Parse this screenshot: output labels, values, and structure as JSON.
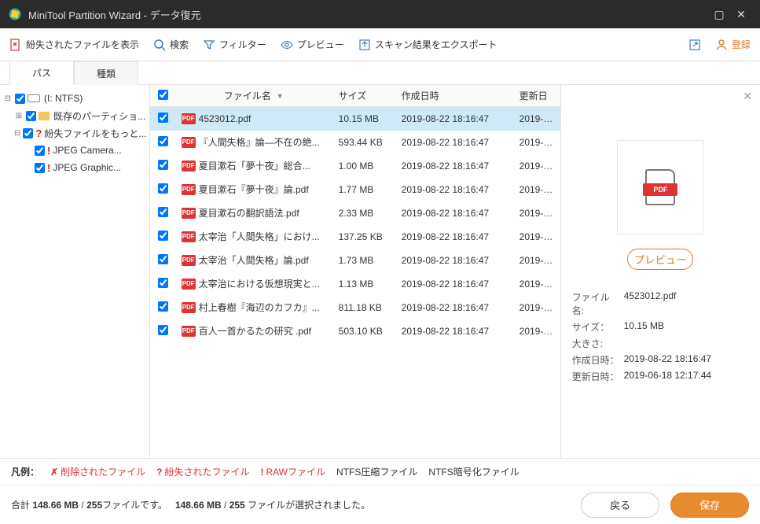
{
  "titlebar": {
    "title": "MiniTool Partition Wizard - データ復元"
  },
  "toolbar": {
    "show_lost": "紛失されたファイルを表示",
    "search": "検索",
    "filter": "フィルター",
    "preview": "プレビュー",
    "export": "スキャン結果をエクスポート",
    "login": "登録"
  },
  "tabs": {
    "path": "パス",
    "type": "種類"
  },
  "tree": {
    "root": "(I: NTFS)",
    "existing": "既存のパーティショ...",
    "lost": "紛失ファイルをもっと...",
    "jpeg_camera": "JPEG Camera...",
    "jpeg_graphic": "JPEG Graphic..."
  },
  "columns": {
    "name": "ファイル名",
    "size": "サイズ",
    "created": "作成日時",
    "updated": "更新日"
  },
  "files": [
    {
      "name": "4523012.pdf",
      "size": "10.15 MB",
      "created": "2019-08-22 18:16:47",
      "updated": "2019-0...",
      "selected": true
    },
    {
      "name": "『人間失格』論―不在の絶...",
      "size": "593.44 KB",
      "created": "2019-08-22 18:16:47",
      "updated": "2019-0..."
    },
    {
      "name": "夏目漱石「夢十夜」総合...",
      "size": "1.00 MB",
      "created": "2019-08-22 18:16:47",
      "updated": "2019-0..."
    },
    {
      "name": "夏目漱石『夢十夜』論.pdf",
      "size": "1.77 MB",
      "created": "2019-08-22 18:16:47",
      "updated": "2019-0..."
    },
    {
      "name": "夏目漱石の翻訳語法.pdf",
      "size": "2.33 MB",
      "created": "2019-08-22 18:16:47",
      "updated": "2019-0..."
    },
    {
      "name": "太宰治「人間失格」におけ...",
      "size": "137.25 KB",
      "created": "2019-08-22 18:16:47",
      "updated": "2019-0..."
    },
    {
      "name": "太宰治「人間失格」論.pdf",
      "size": "1.73 MB",
      "created": "2019-08-22 18:16:47",
      "updated": "2019-0..."
    },
    {
      "name": "太宰治における仮想現実と...",
      "size": "1.13 MB",
      "created": "2019-08-22 18:16:47",
      "updated": "2019-0..."
    },
    {
      "name": "村上春樹『海辺のカフカ』...",
      "size": "811.18 KB",
      "created": "2019-08-22 18:16:47",
      "updated": "2019-0..."
    },
    {
      "name": "百人一首かるたの研究 .pdf",
      "size": "503.10 KB",
      "created": "2019-08-22 18:16:47",
      "updated": "2019-0..."
    }
  ],
  "preview": {
    "button": "プレビュー",
    "pdf_label": "PDF",
    "labels": {
      "filename": "ファイル名:",
      "size": "サイズ：",
      "dim": "大きさ:",
      "created": "作成日時：",
      "updated": "更新日時："
    },
    "filename": "4523012.pdf",
    "size": "10.15 MB",
    "dim": "",
    "created": "2019-08-22 18:16:47",
    "updated": "2019-06-18 12:17:44"
  },
  "legend": {
    "label": "凡例：",
    "deleted": "削除されたファイル",
    "lost": "紛失されたファイル",
    "raw": "RAWファイル",
    "ntfs_comp": "NTFS圧縮ファイル",
    "ntfs_enc": "NTFS暗号化ファイル"
  },
  "footer": {
    "total_label": "合計",
    "total_size": "148.66 MB",
    "sep1": "/",
    "total_files": "255",
    "files_suffix": "ファイルです。",
    "sel_size": "148.66 MB",
    "sep2": "/",
    "sel_files": "255",
    "sel_suffix": "ファイルが選択されました。",
    "back": "戻る",
    "save": "保存"
  }
}
